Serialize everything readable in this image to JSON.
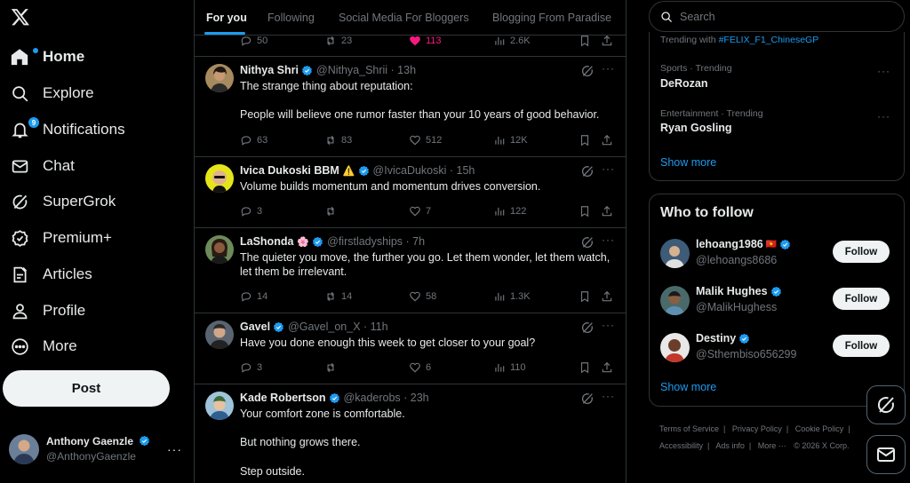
{
  "nav": {
    "items": [
      {
        "label": "Home",
        "icon": "home-icon"
      },
      {
        "label": "Explore",
        "icon": "search-icon"
      },
      {
        "label": "Notifications",
        "icon": "bell-icon",
        "badge": "9"
      },
      {
        "label": "Chat",
        "icon": "mail-icon"
      },
      {
        "label": "SuperGrok",
        "icon": "grok-icon"
      },
      {
        "label": "Premium+",
        "icon": "verified-badge-icon"
      },
      {
        "label": "Articles",
        "icon": "article-icon"
      },
      {
        "label": "Profile",
        "icon": "person-icon"
      },
      {
        "label": "More",
        "icon": "more-circle-icon"
      }
    ],
    "post_label": "Post"
  },
  "account": {
    "name": "Anthony Gaenzle",
    "handle": "@AnthonyGaenzle",
    "more": "···"
  },
  "tabs": [
    "For you",
    "Following",
    "Social Media For Bloggers",
    "Blogging From Paradise"
  ],
  "top_actions": {
    "replies": "50",
    "reposts": "23",
    "likes": "113",
    "views": "2.6K"
  },
  "tweets": [
    {
      "name": "Nithya Shri",
      "meta": "@Nithya_Shrii · 13h",
      "lines": [
        "The strange thing about reputation:",
        "",
        "People will believe one rumor faster than your 10 years of good behavior."
      ],
      "replies": "63",
      "reposts": "83",
      "likes": "512",
      "views": "12K"
    },
    {
      "name": "Ivica Dukoski BBM",
      "emoji": "⚠️",
      "meta": "@IvicaDukoski · 15h",
      "lines": [
        "Volume builds momentum and momentum drives conversion."
      ],
      "replies": "3",
      "reposts": "",
      "likes": "7",
      "views": "122"
    },
    {
      "name": "LaShonda",
      "emoji": "🌸",
      "meta": "@firstladyships · 7h",
      "lines": [
        "The quieter you move, the further you go. Let them wonder, let them watch,",
        "let them be irrelevant."
      ],
      "replies": "14",
      "reposts": "14",
      "likes": "58",
      "views": "1.3K"
    },
    {
      "name": "Gavel",
      "meta": "@Gavel_on_X · 11h",
      "lines": [
        "Have you done enough this week to get closer to your goal?"
      ],
      "replies": "3",
      "reposts": "",
      "likes": "6",
      "views": "110"
    },
    {
      "name": "Kade Robertson",
      "meta": "@kaderobs · 23h",
      "lines": [
        "Your comfort zone is comfortable.",
        "",
        "But nothing grows there.",
        "",
        "Step outside."
      ]
    }
  ],
  "search": {
    "placeholder": "Search"
  },
  "trends": {
    "first_prefix": "Trending with ",
    "first_hashtag": "#FELIX_F1_ChineseGP",
    "items": [
      {
        "category": "Sports · Trending",
        "name": "DeRozan"
      },
      {
        "category": "Entertainment · Trending",
        "name": "Ryan Gosling"
      }
    ],
    "show_more": "Show more",
    "more": "···"
  },
  "who_to_follow": {
    "title": "Who to follow",
    "users": [
      {
        "name": "lehoang1986",
        "flag": "🇻🇳",
        "handle": "@lehoangs8686",
        "button": "Follow"
      },
      {
        "name": "Malik Hughes",
        "handle": "@MalikHughess",
        "button": "Follow"
      },
      {
        "name": "Destiny",
        "handle": "@Sthembiso656299",
        "button": "Follow"
      }
    ],
    "show_more": "Show more"
  },
  "footer": {
    "links": [
      "Terms of Service",
      "Privacy Policy",
      "Cookie Policy",
      "Accessibility",
      "Ads info",
      "More ···",
      "© 2026 X Corp."
    ]
  },
  "colors": {
    "accent": "#1d9bf0",
    "like_active": "#f91880",
    "background": "#000000"
  }
}
